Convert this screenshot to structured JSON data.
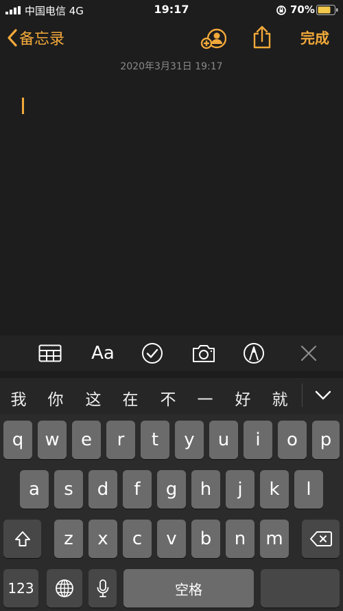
{
  "status": {
    "carrier": "中国电信 4G",
    "time": "19:17",
    "battery": "70%"
  },
  "nav": {
    "back_label": "备忘录",
    "done_label": "完成"
  },
  "note": {
    "date": "2020年3月31日 19:17"
  },
  "toolbar": {
    "icons": [
      "table-icon",
      "text-format-icon",
      "checklist-icon",
      "camera-icon",
      "markup-pen-icon",
      "close-icon"
    ],
    "text_format_label": "Aa"
  },
  "candidates": [
    "我",
    "你",
    "这",
    "在",
    "不",
    "一",
    "好",
    "就"
  ],
  "keyboard": {
    "row1": [
      "q",
      "w",
      "e",
      "r",
      "t",
      "y",
      "u",
      "i",
      "o",
      "p"
    ],
    "row2": [
      "a",
      "s",
      "d",
      "f",
      "g",
      "h",
      "j",
      "k",
      "l"
    ],
    "row3": [
      "z",
      "x",
      "c",
      "v",
      "b",
      "n",
      "m"
    ],
    "numbers_label": "123",
    "space_label": "空格"
  },
  "colors": {
    "accent": "#f2a93a",
    "background": "#1d1d1d",
    "key": "#6b6b6b",
    "key_dark": "#474747"
  }
}
